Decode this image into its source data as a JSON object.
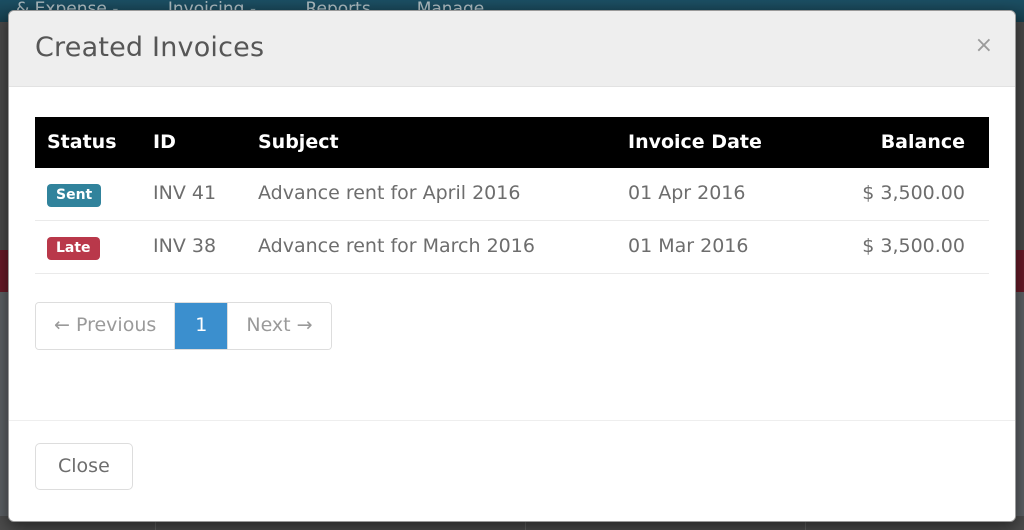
{
  "background": {
    "navbar_items": [
      {
        "label": "& Expense",
        "has_caret": true
      },
      {
        "label": "Invoicing",
        "has_caret": true
      },
      {
        "label": "Reports",
        "has_caret": false
      },
      {
        "label": "Manage",
        "has_caret": false
      }
    ],
    "navbar_color": "#1f5568",
    "band_color": "#7d2030"
  },
  "modal": {
    "title": "Created Invoices",
    "close_icon": "×",
    "table": {
      "headers": [
        "Status",
        "ID",
        "Subject",
        "Invoice Date",
        "Balance"
      ],
      "rows": [
        {
          "status": "Sent",
          "status_color": "#31839c",
          "id": "INV 41",
          "subject": "Advance rent for April 2016",
          "invoice_date": "01 Apr 2016",
          "balance": "$ 3,500.00"
        },
        {
          "status": "Late",
          "status_color": "#b9384a",
          "id": "INV 38",
          "subject": "Advance rent for March 2016",
          "invoice_date": "01 Mar 2016",
          "balance": "$ 3,500.00"
        }
      ]
    },
    "pagination": {
      "previous_label": "← Previous",
      "current_page": "1",
      "next_label": "Next →",
      "active_color": "#3b8fce"
    },
    "footer": {
      "close_button_label": "Close"
    }
  }
}
